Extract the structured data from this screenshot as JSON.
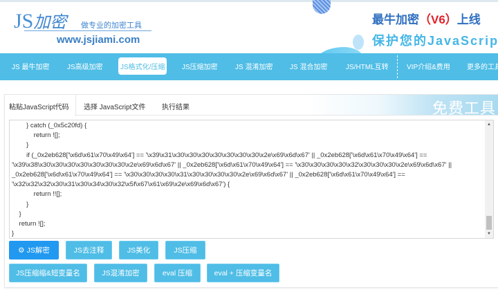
{
  "header": {
    "logo_latin": "JS",
    "logo_cn": "加密",
    "slogan": "做专业的加密工具",
    "url": "www.jsjiami.com",
    "ad_line1_a": "最牛加密",
    "ad_line1_b": "（V6）",
    "ad_line1_c": "上线",
    "ad_line2": "保护您的JavaScript"
  },
  "nav": {
    "items": [
      "JS 最牛加密",
      "JS高级加密",
      "JS格式化/压缩",
      "JS压缩加密",
      "JS 混淆加密",
      "JS 混合加密",
      "JS/HTML互转",
      "VIP介绍&费用",
      "更多的工具"
    ]
  },
  "tabs": {
    "items": [
      "粘贴JavaScript代码",
      "选择 JavaScript文件",
      "执行结果"
    ],
    "banner": "免费工具"
  },
  "editor": {
    "lines": [
      "        } catch (_0x5c20fd) {",
      "            return ![];",
      "        }",
      "        if (_0x2eb628['\\x6d\\x61\\x70\\x49\\x64'] == '\\x39\\x31\\x30\\x30\\x30\\x30\\x30\\x30\\x30\\x2e\\x69\\x6d\\x67' || _0x2eb628['\\x6d\\x61\\x70\\x49\\x64'] ==",
      "'\\x39\\x38\\x30\\x30\\x30\\x30\\x30\\x30\\x30\\x2e\\x69\\x6d\\x67' || _0x2eb628['\\x6d\\x61\\x70\\x49\\x64'] == '\\x30\\x30\\x30\\x30\\x32\\x30\\x30\\x30\\x2e\\x69\\x6d\\x67' ||",
      "_0x2eb628['\\x6d\\x61\\x70\\x49\\x64'] == '\\x30\\x30\\x30\\x30\\x31\\x30\\x30\\x30\\x30\\x2e\\x69\\x6d\\x67' || _0x2eb628['\\x6d\\x61\\x70\\x49\\x64'] ==",
      "'\\x32\\x32\\x32\\x30\\x31\\x30\\x34\\x30\\x32\\x5f\\x67\\x61\\x69\\x2e\\x69\\x6d\\x67') {",
      "            return !![];",
      "        }",
      "    }",
      "    return ![];",
      "}"
    ]
  },
  "buttons": {
    "row1": [
      "JS解密",
      "JS去注释",
      "JS美化",
      "JS压缩"
    ],
    "row2": [
      "JS压缩缩&短变量名",
      "JS混淆加密",
      "eval 压缩",
      "eval + 压缩变量名"
    ]
  }
}
